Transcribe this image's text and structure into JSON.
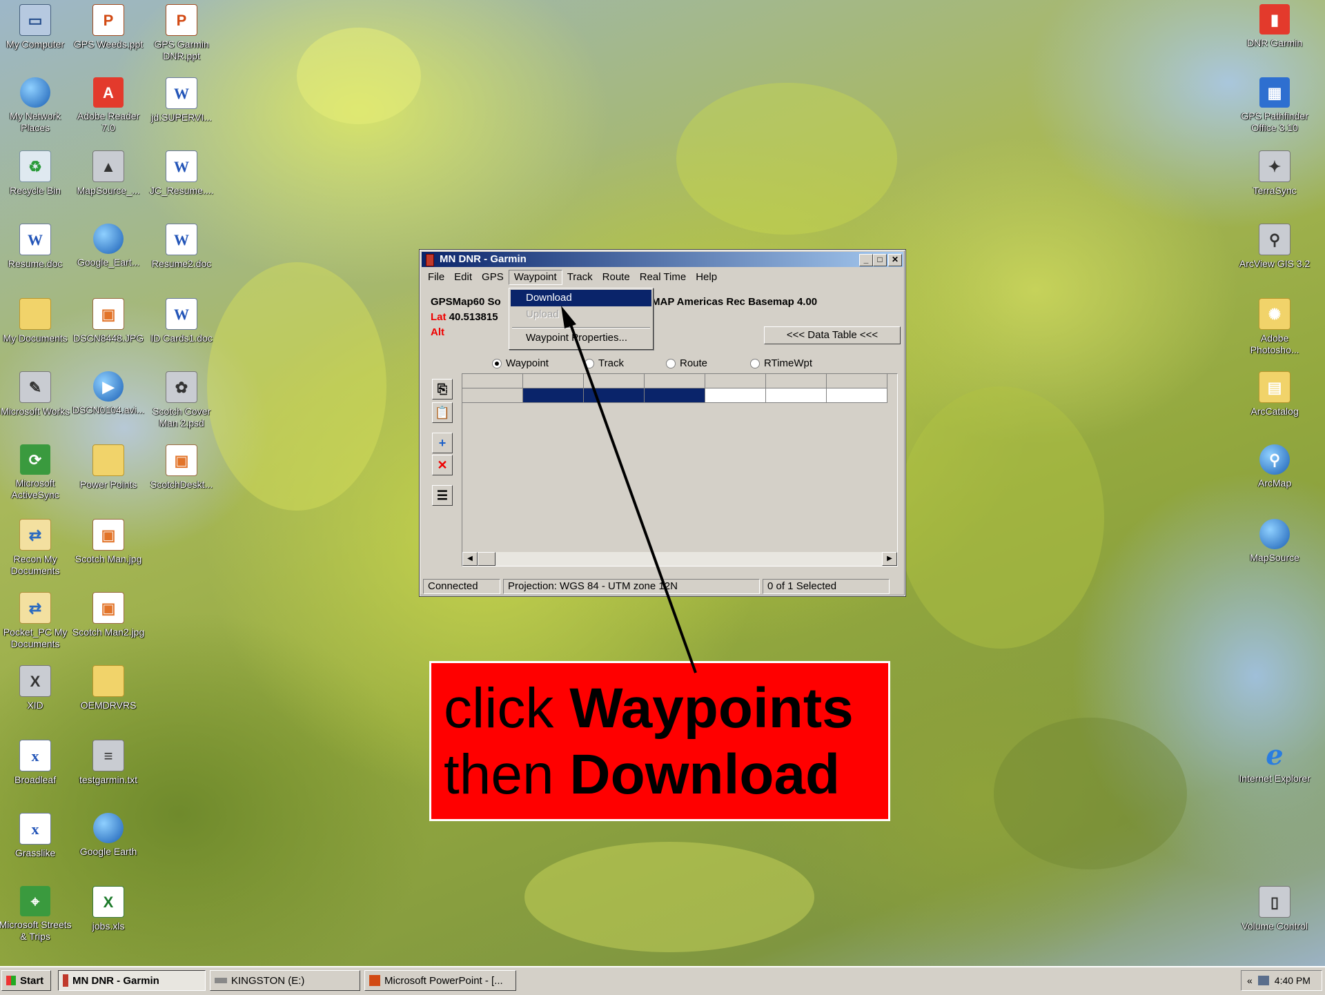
{
  "desktop_icons_left": [
    {
      "label": "My Computer",
      "icon": "my-computer-icon"
    },
    {
      "label": "GPS Weeds.ppt",
      "icon": "powerpoint-file-icon"
    },
    {
      "label": "GPS Garmin DNR.ppt",
      "icon": "powerpoint-file-icon"
    },
    {
      "label": "My Network Places",
      "icon": "network-places-icon"
    },
    {
      "label": "Adobe Reader 7.0",
      "icon": "adobe-reader-icon"
    },
    {
      "label": "jd.SUPERVI...",
      "icon": "word-document-icon"
    },
    {
      "label": "Recycle Bin",
      "icon": "recycle-bin-icon"
    },
    {
      "label": "MapSource_...",
      "icon": "mapsource-icon"
    },
    {
      "label": "JC_Resume....",
      "icon": "word-document-icon"
    },
    {
      "label": "Resume.doc",
      "icon": "word-document-icon"
    },
    {
      "label": "Google_Eart...",
      "icon": "google-earth-icon"
    },
    {
      "label": "Resume2.doc",
      "icon": "word-document-icon"
    },
    {
      "label": "My Documents",
      "icon": "my-documents-icon"
    },
    {
      "label": "DSCN8448.JPG",
      "icon": "image-file-icon"
    },
    {
      "label": "ID Cards1.doc",
      "icon": "word-document-icon"
    },
    {
      "label": "Microsoft Works",
      "icon": "microsoft-works-icon"
    },
    {
      "label": "DSCN0104.avi...",
      "icon": "video-file-icon"
    },
    {
      "label": "Scotch Cover Man 2.psd",
      "icon": "photoshop-file-icon"
    },
    {
      "label": "Microsoft ActiveSync",
      "icon": "activesync-icon"
    },
    {
      "label": "Power Points",
      "icon": "folder-icon"
    },
    {
      "label": "ScotchDeskt...",
      "icon": "image-file-icon"
    },
    {
      "label": "Recon My Documents",
      "icon": "briefcase-sync-icon"
    },
    {
      "label": "Scotch Man.jpg",
      "icon": "image-file-icon"
    },
    {
      "label": "Pocket_PC My Documents",
      "icon": "briefcase-sync-icon"
    },
    {
      "label": "Scotch Man2.jpg",
      "icon": "image-file-icon"
    },
    {
      "label": "XID",
      "icon": "xid-icon"
    },
    {
      "label": "OEMDRVRS",
      "icon": "folder-icon"
    },
    {
      "label": "Broadleaf",
      "icon": "xml-file-icon"
    },
    {
      "label": "testgarmin.txt",
      "icon": "text-file-icon"
    },
    {
      "label": "Grasslike",
      "icon": "xml-file-icon"
    },
    {
      "label": "Google Earth",
      "icon": "google-earth-icon"
    },
    {
      "label": "Microsoft Streets & Trips",
      "icon": "streets-trips-icon"
    },
    {
      "label": "jobs.xls",
      "icon": "excel-file-icon"
    }
  ],
  "desktop_icons_right": [
    {
      "label": "DNR Garmin",
      "icon": "dnr-garmin-icon"
    },
    {
      "label": "GPS Pathfinder Office 3.10",
      "icon": "pathfinder-icon"
    },
    {
      "label": "TerraSync",
      "icon": "terrasync-icon"
    },
    {
      "label": "ArcView GIS 3.2",
      "icon": "arcview-icon"
    },
    {
      "label": "Adobe Photosho...",
      "icon": "photoshop-icon"
    },
    {
      "label": "ArcCatalog",
      "icon": "arccatalog-icon"
    },
    {
      "label": "ArcMap",
      "icon": "arcmap-icon"
    },
    {
      "label": "MapSource",
      "icon": "mapsource-globe-icon"
    },
    {
      "label": "Internet Explorer",
      "icon": "internet-explorer-icon"
    },
    {
      "label": "Volume Control",
      "icon": "volume-control-icon"
    }
  ],
  "window": {
    "title": "MN DNR - Garmin",
    "menu": [
      "File",
      "Edit",
      "GPS",
      "Waypoint",
      "Track",
      "Route",
      "Real Time",
      "Help"
    ],
    "device_line": "GPSMap60 So",
    "map_line": "MAP Americas Rec Basemap 4.00",
    "lat_label": "Lat",
    "lat_value": "40.513815",
    "alt_label": "Alt",
    "data_table_button": "<<< Data Table <<<",
    "radios": [
      {
        "label": "Waypoint",
        "selected": true
      },
      {
        "label": "Track",
        "selected": false
      },
      {
        "label": "Route",
        "selected": false
      },
      {
        "label": "RTimeWpt",
        "selected": false
      }
    ],
    "status": {
      "connection": "Connected",
      "projection": "Projection: WGS 84 - UTM zone 12N",
      "selection": "0 of 1 Selected"
    }
  },
  "waypoint_menu": {
    "items": [
      {
        "label": "Download",
        "state": "highlighted"
      },
      {
        "label": "Upload",
        "state": "disabled"
      },
      {
        "label": "Waypoint Properties...",
        "state": "enabled"
      }
    ]
  },
  "callout": {
    "line1_normal": "click ",
    "line1_bold": "Waypoints",
    "line2_normal": "then ",
    "line2_bold": "Download"
  },
  "taskbar": {
    "start": "Start",
    "tasks": [
      "MN DNR - Garmin",
      "KINGSTON (E:)",
      "Microsoft PowerPoint - [..."
    ],
    "active_task": "MN DNR - Garmin",
    "clock": "4:40 PM"
  },
  "colors": {
    "callout_bg": "#ff0000",
    "titlebar": "#0a246a",
    "selection": "#0a246a",
    "lat_alt_labels": "#e00000"
  }
}
